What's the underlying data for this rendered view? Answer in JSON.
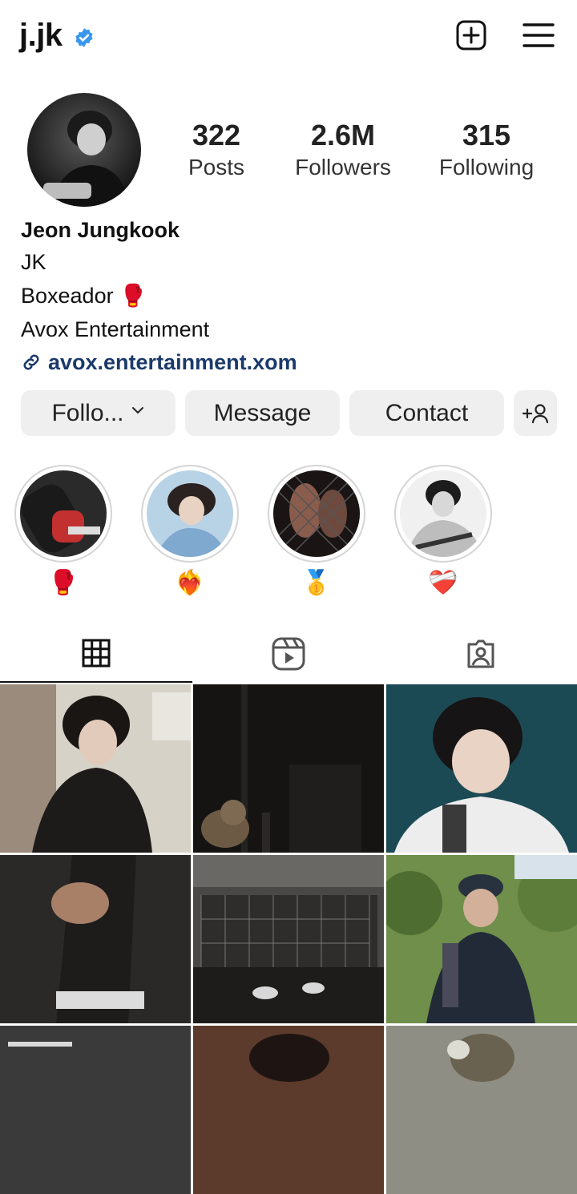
{
  "header": {
    "username": "j.jk",
    "verified_icon": "verified-badge-icon",
    "new_post_icon": "plus-square-icon",
    "menu_icon": "hamburger-menu-icon"
  },
  "profile": {
    "stats": {
      "posts": {
        "value": "322",
        "label": "Posts"
      },
      "followers": {
        "value": "2.6M",
        "label": "Followers"
      },
      "following": {
        "value": "315",
        "label": "Following"
      }
    },
    "name": "Jeon Jungkook",
    "bio_lines": [
      "JK",
      "Boxeador 🥊",
      "Avox Entertainment"
    ],
    "link": "avox.entertainment.xom"
  },
  "actions": {
    "follow": "Follo...",
    "message": "Message",
    "contact": "Contact"
  },
  "highlights": [
    {
      "caption": "🥊"
    },
    {
      "caption": "❤️‍🔥"
    },
    {
      "caption": "🥇"
    },
    {
      "caption": "❤️‍🩹"
    }
  ],
  "tabs": [
    "posts-grid",
    "reels",
    "tagged"
  ],
  "colors": {
    "verified": "#3897f0",
    "link": "#1b3a6b",
    "button_bg": "#efefef"
  }
}
